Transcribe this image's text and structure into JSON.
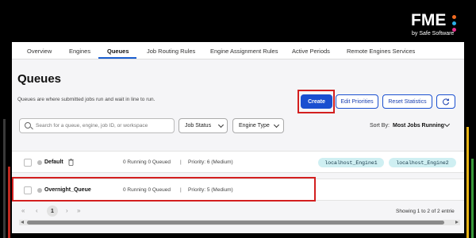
{
  "brand": {
    "logo_text": "FME",
    "logo_sub": "by Safe Software",
    "dot_colors": [
      "#f26b21",
      "#2bb0e8",
      "#e8308c"
    ]
  },
  "tabs": [
    {
      "label": "Overview"
    },
    {
      "label": "Engines"
    },
    {
      "label": "Queues",
      "active": true
    },
    {
      "label": "Job Routing Rules"
    },
    {
      "label": "Engine Assignment Rules"
    },
    {
      "label": "Active Periods"
    },
    {
      "label": "Remote Engines Services"
    }
  ],
  "page": {
    "title": "Queues",
    "description": "Queues are where submitted jobs run and wait in line to run."
  },
  "actions": {
    "create": "Create",
    "edit_priorities": "Edit Priorities",
    "reset_statistics": "Reset Statistics",
    "refresh_icon": "refresh-icon"
  },
  "filters": {
    "search_placeholder": "Search for a queue, engine, job ID, or workspace",
    "job_status": "Job Status",
    "engine_type": "Engine Type",
    "sort_label": "Sort By:",
    "sort_value": "Most Jobs Running"
  },
  "queues": [
    {
      "name": "Default",
      "stats": "0 Running  0 Queued",
      "separator": "|",
      "priority": "Priority: 6 (Medium)",
      "engines": [
        "localhost_Engine1",
        "localhost_Engine2"
      ]
    },
    {
      "name": "Overnight_Queue",
      "stats": "0 Running  0 Queued",
      "separator": "|",
      "priority": "Priority: 5 (Medium)",
      "engines": []
    }
  ],
  "pagination": {
    "first": "«",
    "prev": "‹",
    "current": "1",
    "next": "›",
    "last": "»",
    "showing": "Showing 1 to 2 of 2 entrie"
  },
  "colors": {
    "accent": "#1a4fd0",
    "highlight_box": "#d31f1f",
    "engine_tag_bg": "#cfeff2"
  }
}
